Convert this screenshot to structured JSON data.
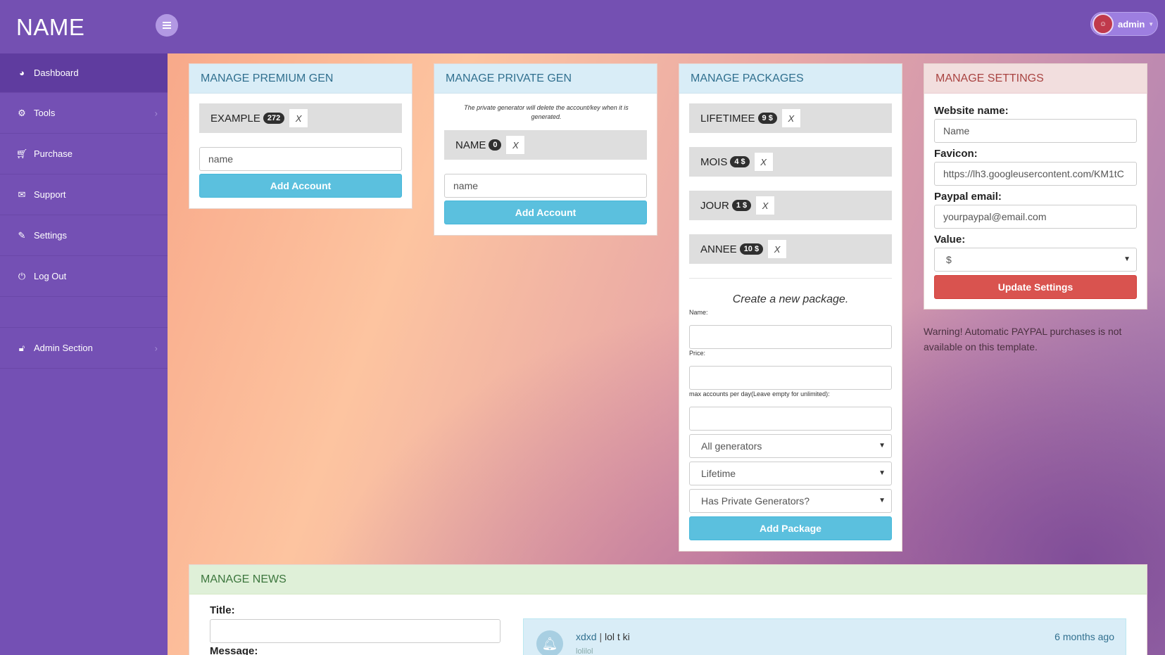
{
  "brand": "NAME",
  "user": {
    "name": "admin"
  },
  "sidebar": {
    "items": [
      {
        "label": "Dashboard",
        "icon": "dashboard-icon"
      },
      {
        "label": "Tools",
        "icon": "gears-icon"
      },
      {
        "label": "Purchase",
        "icon": "cart-icon"
      },
      {
        "label": "Support",
        "icon": "chat-icon"
      },
      {
        "label": "Settings",
        "icon": "wrench-icon"
      },
      {
        "label": "Log Out",
        "icon": "power-icon"
      }
    ],
    "admin": {
      "label": "Admin Section",
      "icon": "unlock-icon"
    }
  },
  "premium": {
    "title": "MANAGE PREMIUM GEN",
    "item": {
      "name": "EXAMPLE",
      "count": "272",
      "remove": "X"
    },
    "input_value": "name",
    "button": "Add Account"
  },
  "private": {
    "title": "MANAGE PRIVATE GEN",
    "note": "The private generator will delete the account/key when it is generated.",
    "item": {
      "name": "NAME",
      "count": "0",
      "remove": "X"
    },
    "input_value": "name",
    "button": "Add Account"
  },
  "packages": {
    "title": "MANAGE PACKAGES",
    "items": [
      {
        "name": "LIFETIMEE",
        "price": "9 $",
        "remove": "X"
      },
      {
        "name": "MOIS",
        "price": "4 $",
        "remove": "X"
      },
      {
        "name": "JOUR",
        "price": "1 $",
        "remove": "X"
      },
      {
        "name": "ANNEE",
        "price": "10 $",
        "remove": "X"
      }
    ],
    "create_heading": "Create a new package.",
    "name_label": "Name:",
    "price_label": "Price:",
    "max_label": "max accounts per day(Leave empty for unlimited):",
    "select_generators": "All generators",
    "select_duration": "Lifetime",
    "select_private": "Has Private Generators?",
    "button": "Add Package"
  },
  "settings": {
    "title": "MANAGE SETTINGS",
    "website_label": "Website name:",
    "website_value": "Name",
    "favicon_label": "Favicon:",
    "favicon_value": "https://lh3.googleusercontent.com/KM1tC",
    "paypal_label": "Paypal email:",
    "paypal_value": "yourpaypal@email.com",
    "value_label": "Value:",
    "value_selected": "$",
    "button": "Update Settings",
    "warning": "Warning! Automatic PAYPAL purchases is not available on this template."
  },
  "news": {
    "title": "MANAGE NEWS",
    "title_label": "Title:",
    "message_label": "Message:",
    "item": {
      "author": "xdxd",
      "separator": " | ",
      "headline": "lol t ki",
      "time": "6 months ago",
      "body": "lolilol"
    }
  },
  "colors": {
    "header": "#7450b2",
    "sidebar_active": "#5f3c9f",
    "info": "#5bc0de",
    "danger": "#d9534f"
  }
}
